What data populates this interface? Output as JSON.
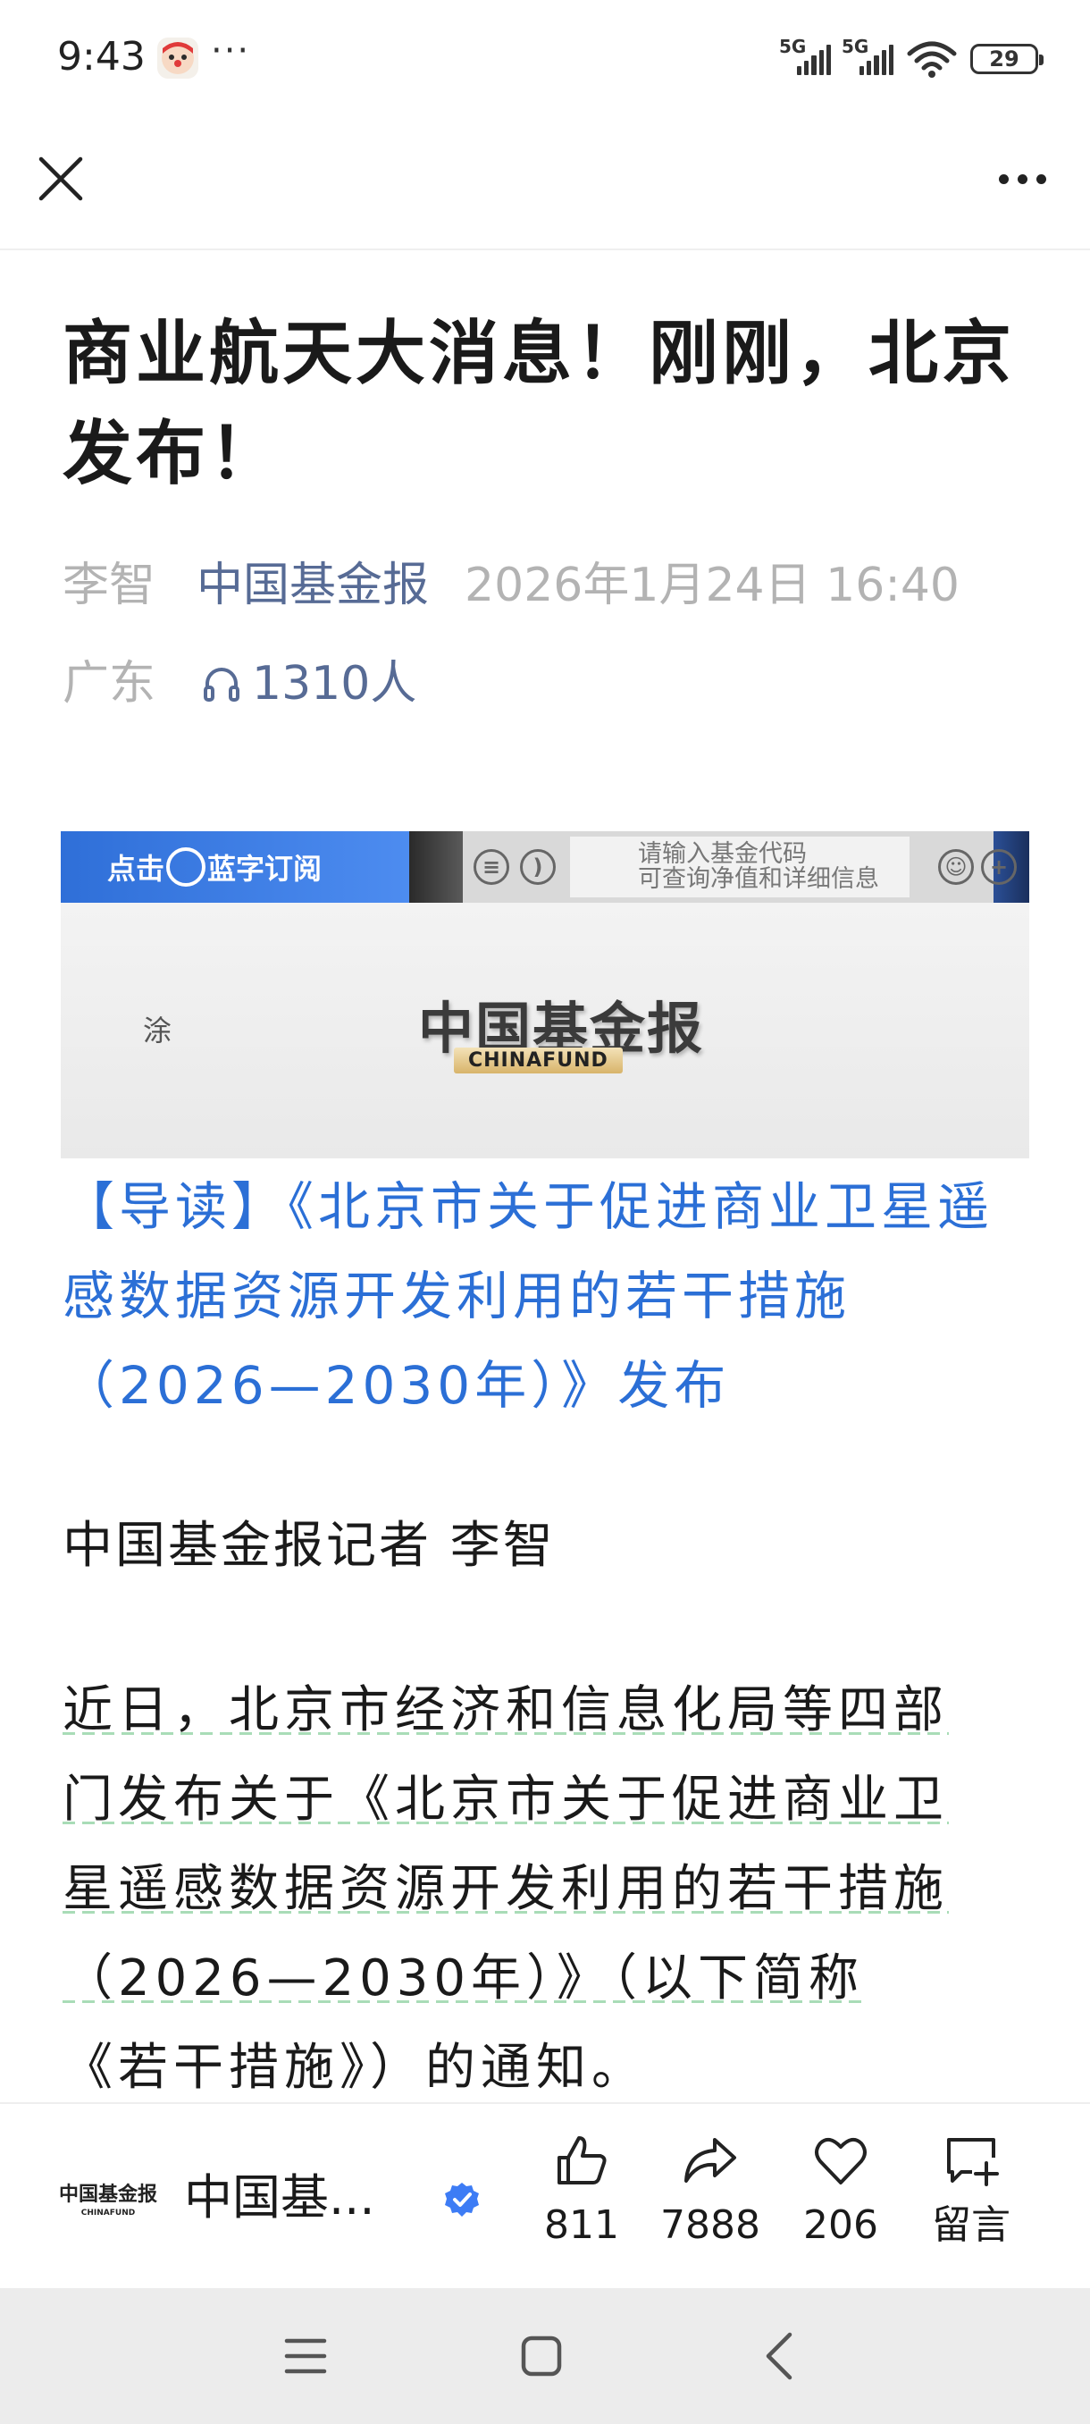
{
  "status_bar": {
    "time": "9:43",
    "more": "···",
    "signal_1_label": "5G",
    "signal_2_label": "5G",
    "battery_level": "29"
  },
  "nav": {
    "close_icon": "close-icon",
    "more_icon": "more-horizontal-icon"
  },
  "article": {
    "title": "商业航天大消息！刚刚，北京发布！",
    "author": "李智",
    "account": "中国基金报",
    "datetime": "2026年1月24日 16:40",
    "location": "广东",
    "listen_count": "1310人",
    "banner": {
      "subscribe_prefix": "点击",
      "subscribe_suffix": "蓝字订阅",
      "search_line_1": "请输入基金代码",
      "search_line_2": "可查询净值和详细信息",
      "side_char": "涂",
      "logo_cn": "中国基金报",
      "logo_en": "CHINAFUND"
    },
    "lead": "【导读】《北京市关于促进商业卫星遥感数据资源开发利用的若干措施（2026—2030年）》发布",
    "byline": "中国基金报记者 李智",
    "paragraph": {
      "line1": "近日，北京市经济和信息化局等四部",
      "line2": "门发布关于《北京市关于促进商业卫",
      "line3": "星遥感数据资源开发利用的若干措施",
      "line4": "（2026—2030年）》（以下简称",
      "line5": "《若干措施》）的通知。"
    }
  },
  "action_bar": {
    "account_name": "中国基...",
    "logo_cn": "中国基金报",
    "logo_en": "CHINAFUND",
    "like_count": "811",
    "share_count": "7888",
    "favorite_count": "206",
    "comment_label": "留言"
  },
  "colors": {
    "link_blue": "#2b6fd6",
    "account_blue": "#576b95",
    "meta_gray": "#b3b3b3",
    "verified_blue": "#3d7cf5"
  }
}
